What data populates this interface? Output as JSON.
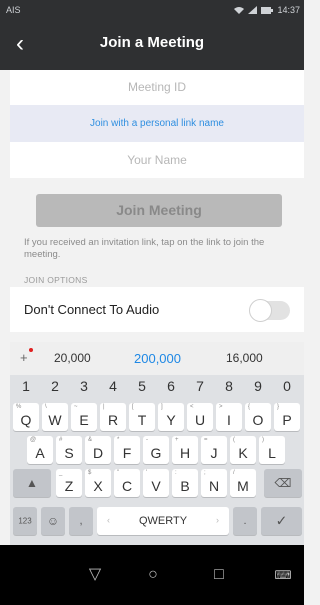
{
  "status": {
    "carrier": "AIS",
    "time": "14:37",
    "icons": [
      "wifi-icon",
      "signal-icon",
      "battery-icon"
    ]
  },
  "header": {
    "title": "Join a Meeting",
    "back_icon": "chevron-left-icon"
  },
  "form": {
    "meeting_id_placeholder": "Meeting ID",
    "personal_link_label": "Join with a personal link name",
    "name_placeholder": "Your Name",
    "join_button": "Join Meeting",
    "invite_hint": "If you received an invitation link, tap on the link to join the meeting."
  },
  "options": {
    "section_label": "JOIN OPTIONS",
    "dont_connect_audio": "Don't Connect To Audio",
    "dont_connect_audio_on": false
  },
  "suggestions": [
    "20,000",
    "200,000",
    "16,000"
  ],
  "keyboard": {
    "numbers": [
      "1",
      "2",
      "3",
      "4",
      "5",
      "6",
      "7",
      "8",
      "9",
      "0"
    ],
    "row1": [
      {
        "k": "Q",
        "s": "%"
      },
      {
        "k": "W",
        "s": "\\"
      },
      {
        "k": "E",
        "s": "~"
      },
      {
        "k": "R",
        "s": "|"
      },
      {
        "k": "T",
        "s": "["
      },
      {
        "k": "Y",
        "s": "]"
      },
      {
        "k": "U",
        "s": "<"
      },
      {
        "k": "I",
        "s": ">"
      },
      {
        "k": "O",
        "s": "{"
      },
      {
        "k": "P",
        "s": "}"
      }
    ],
    "row2": [
      {
        "k": "A",
        "s": "@"
      },
      {
        "k": "S",
        "s": "#"
      },
      {
        "k": "D",
        "s": "&"
      },
      {
        "k": "F",
        "s": "*"
      },
      {
        "k": "G",
        "s": "-"
      },
      {
        "k": "H",
        "s": "+"
      },
      {
        "k": "J",
        "s": "="
      },
      {
        "k": "K",
        "s": "("
      },
      {
        "k": "L",
        "s": ")"
      }
    ],
    "row3": [
      {
        "k": "Z",
        "s": "_"
      },
      {
        "k": "X",
        "s": "$"
      },
      {
        "k": "C",
        "s": "\""
      },
      {
        "k": "V",
        "s": "'"
      },
      {
        "k": "B",
        "s": ":"
      },
      {
        "k": "N",
        "s": ";"
      },
      {
        "k": "M",
        "s": "/"
      }
    ],
    "num_switch": "123",
    "space_label": "QWERTY",
    "comma": ","
  },
  "colors": {
    "header_bg": "#2f3032",
    "accent": "#1e88e5",
    "join_disabled": "#b9b9b9"
  }
}
